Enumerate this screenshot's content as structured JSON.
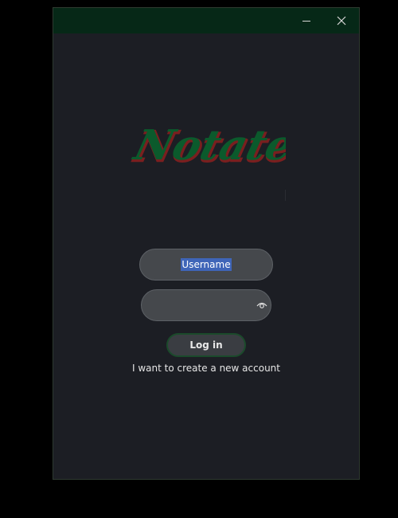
{
  "window": {
    "titlebar_color": "#062817",
    "background_color": "#1c1e24",
    "minimize_icon": "minimize-icon",
    "close_icon": "close-icon"
  },
  "logo": {
    "text": "Notatek",
    "fill_color": "#0b5a2c",
    "outline_color": "#7a1f1f"
  },
  "login_form": {
    "username_value": "Username",
    "username_selected": true,
    "password_value": "",
    "password_toggle_icon": "eye-icon",
    "login_label": "Log in",
    "create_account_label": "I want to create a new account",
    "accent_color": "#1b4a2b",
    "selection_color": "#3f65b8"
  }
}
